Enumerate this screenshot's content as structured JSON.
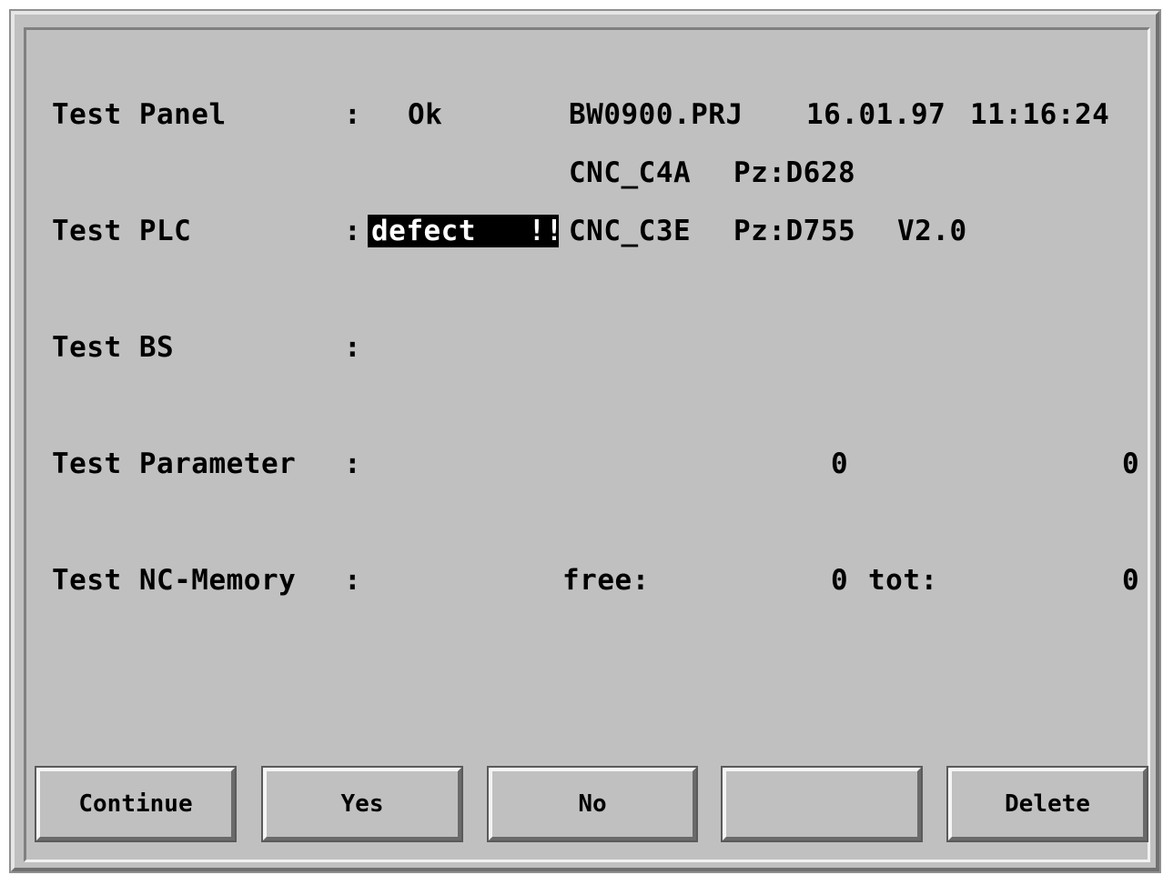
{
  "rows": {
    "panel": {
      "label": "Test Panel",
      "colon": ":",
      "status": "Ok",
      "project": "BW0900.PRJ",
      "date": "16.01.97",
      "time": "11:16:24"
    },
    "cnc_c4a": {
      "module": "CNC_C4A",
      "pz": "Pz:D628"
    },
    "plc": {
      "label": "Test PLC",
      "colon": ":",
      "status": "defect   !!",
      "module": "CNC_C3E",
      "pz": "Pz:D755",
      "version": "V2.0"
    },
    "bs": {
      "label": "Test BS",
      "colon": ":"
    },
    "parameter": {
      "label": "Test Parameter",
      "colon": ":",
      "value1": "0",
      "value2": "0"
    },
    "memory": {
      "label": "Test NC-Memory",
      "colon": ":",
      "free_label": "free:",
      "free_value": "0",
      "tot_label": "tot:",
      "tot_value": "0"
    }
  },
  "buttons": {
    "continue": "Continue",
    "yes": "Yes",
    "no": "No",
    "empty": "",
    "delete": "Delete"
  },
  "colors": {
    "background": "#c0c0c0",
    "text": "#000000",
    "highlight_bg": "#000000",
    "highlight_text": "#ffffff"
  }
}
